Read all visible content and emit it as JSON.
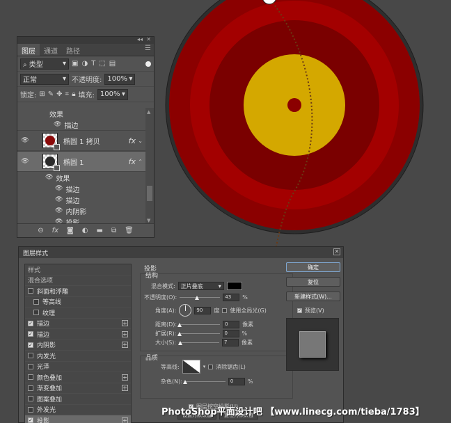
{
  "layers_panel": {
    "tabs": [
      "图层",
      "通道",
      "路径"
    ],
    "filter_kind": "类型",
    "blend_mode": "正常",
    "opacity_label": "不透明度:",
    "opacity_value": "100%",
    "lock_label": "锁定:",
    "fill_label": "填充:",
    "fill_value": "100%",
    "layers": [
      {
        "type": "effect-header",
        "label": "效果"
      },
      {
        "type": "effect",
        "label": "描边"
      },
      {
        "type": "layer",
        "label": "椭圆 1 拷贝",
        "thumb_color": "#8b0a0a",
        "selected": false
      },
      {
        "type": "layer",
        "label": "椭圆 1",
        "thumb_color": "#2a2a2a",
        "selected": true
      },
      {
        "type": "effect-header",
        "label": "效果"
      },
      {
        "type": "effect",
        "label": "描边"
      },
      {
        "type": "effect",
        "label": "描边"
      },
      {
        "type": "effect",
        "label": "内阴影"
      },
      {
        "type": "effect",
        "label": "投影"
      }
    ],
    "fx_label": "fx"
  },
  "dialog": {
    "title": "图层样式",
    "styles": [
      {
        "label": "样式",
        "header": true
      },
      {
        "label": "混合选项",
        "header": true
      },
      {
        "label": "斜面和浮雕",
        "checked": false,
        "plus": false
      },
      {
        "label": "等高线",
        "checked": false,
        "indent": true
      },
      {
        "label": "纹理",
        "checked": false,
        "indent": true
      },
      {
        "label": "描边",
        "checked": true,
        "plus": true
      },
      {
        "label": "描边",
        "checked": true,
        "plus": true
      },
      {
        "label": "内阴影",
        "checked": true,
        "plus": true
      },
      {
        "label": "内发光",
        "checked": false,
        "plus": false
      },
      {
        "label": "光泽",
        "checked": false,
        "plus": false
      },
      {
        "label": "颜色叠加",
        "checked": false,
        "plus": true
      },
      {
        "label": "渐变叠加",
        "checked": false,
        "plus": true
      },
      {
        "label": "图案叠加",
        "checked": false,
        "plus": false
      },
      {
        "label": "外发光",
        "checked": false,
        "plus": false
      },
      {
        "label": "投影",
        "checked": true,
        "plus": true,
        "selected": true
      }
    ],
    "section_title": "投影",
    "structure_title": "结构",
    "blend_label": "混合模式:",
    "blend_value": "正片叠底",
    "opacity_label": "不透明度(O):",
    "opacity_value": "43",
    "percent": "%",
    "angle_label": "角度(A):",
    "angle_value": "90",
    "degree": "度",
    "global_light_label": "使用全局光(G)",
    "distance_label": "距离(D):",
    "distance_value": "0",
    "spread_label": "扩展(R):",
    "spread_value": "0",
    "size_label": "大小(S):",
    "size_value": "7",
    "px": "像素",
    "quality_title": "品质",
    "contour_label": "等高线:",
    "antialias_label": "消除锯齿(L)",
    "noise_label": "杂色(N):",
    "noise_value": "0",
    "knockout_label": "图层挖空投影(U)",
    "set_default": "设置为默认值",
    "reset_default": "复位为默认值",
    "buttons": {
      "ok": "确定",
      "reset": "复位",
      "new_style": "新建样式(W)...",
      "preview": "预览(V)"
    },
    "slider_fraction": {
      "opacity": 0.43,
      "distance": 0,
      "spread": 0,
      "size": 0.03,
      "noise": 0
    }
  },
  "target": {
    "colors": {
      "outer_ring": "#8b0000",
      "mid_ring": "#a30000",
      "inner_ring": "#7a0000",
      "yellow": "#d4a800",
      "center_dot": "#8b0000",
      "rim": "#2e2e2e"
    }
  },
  "watermark": "PhotoShop平面设计吧 【www.linecg.com/tieba/1783】"
}
